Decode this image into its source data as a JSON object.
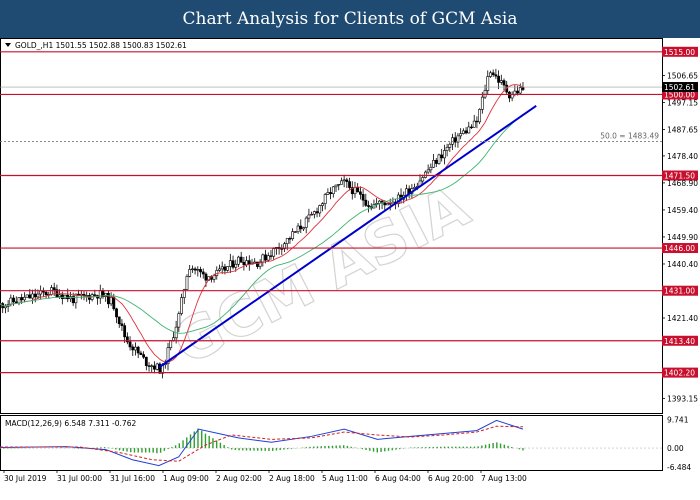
{
  "header": {
    "title": "Chart Analysis for Clients of GCM Asia"
  },
  "chart_data": {
    "type": "candlestick",
    "symbol_info": "GOLD_,H1  1501.55 1502.88 1500.83 1502.61",
    "watermark": "GCM ASIA",
    "ylim": [
      1388.0,
      1519.5
    ],
    "y_ticks": [
      "1506.65",
      "1497.15",
      "1487.65",
      "1478.40",
      "1468.90",
      "1459.40",
      "1449.90",
      "1440.40",
      "1421.40",
      "1393.15"
    ],
    "x_ticks": [
      "30 Jul 2019",
      "31 Jul 00:00",
      "31 Jul 16:00",
      "1 Aug 09:00",
      "2 Aug 02:00",
      "2 Aug 18:00",
      "5 Aug 11:00",
      "6 Aug 04:00",
      "6 Aug 20:00",
      "7 Aug 13:00"
    ],
    "current_price": "1502.61",
    "levels": [
      {
        "value": 1515.0,
        "label": "1515.00"
      },
      {
        "value": 1500.0,
        "label": "1500.00"
      },
      {
        "value": 1471.5,
        "label": "1471.50"
      },
      {
        "value": 1446.0,
        "label": "1446.00"
      },
      {
        "value": 1431.0,
        "label": "1431.00"
      },
      {
        "value": 1413.4,
        "label": "1413.40"
      },
      {
        "value": 1402.2,
        "label": "1402.20"
      }
    ],
    "fib": {
      "value": 1483.49,
      "label": "50.0 = 1483.49"
    },
    "trendline": {
      "from": [
        1404.0,
        0.24
      ],
      "to": [
        1496.0,
        0.81
      ]
    },
    "key_closes": [
      {
        "t": 0.0,
        "v": 1426
      },
      {
        "t": 0.05,
        "v": 1429
      },
      {
        "t": 0.08,
        "v": 1431
      },
      {
        "t": 0.11,
        "v": 1428
      },
      {
        "t": 0.15,
        "v": 1430
      },
      {
        "t": 0.17,
        "v": 1427
      },
      {
        "t": 0.19,
        "v": 1414
      },
      {
        "t": 0.22,
        "v": 1406
      },
      {
        "t": 0.245,
        "v": 1403
      },
      {
        "t": 0.27,
        "v": 1422
      },
      {
        "t": 0.285,
        "v": 1440
      },
      {
        "t": 0.31,
        "v": 1436
      },
      {
        "t": 0.33,
        "v": 1437
      },
      {
        "t": 0.36,
        "v": 1442
      },
      {
        "t": 0.39,
        "v": 1441
      },
      {
        "t": 0.43,
        "v": 1448
      },
      {
        "t": 0.47,
        "v": 1457
      },
      {
        "t": 0.5,
        "v": 1466
      },
      {
        "t": 0.52,
        "v": 1469
      },
      {
        "t": 0.56,
        "v": 1461
      },
      {
        "t": 0.6,
        "v": 1463
      },
      {
        "t": 0.63,
        "v": 1469
      },
      {
        "t": 0.66,
        "v": 1477
      },
      {
        "t": 0.69,
        "v": 1485
      },
      {
        "t": 0.72,
        "v": 1490
      },
      {
        "t": 0.74,
        "v": 1509
      },
      {
        "t": 0.77,
        "v": 1500
      },
      {
        "t": 0.79,
        "v": 1502
      }
    ],
    "macd": {
      "label": "MACD(12,26,9) 6.548 7.311 -0.762",
      "y_ticks": [
        "9.741",
        "0.00",
        "-6.484"
      ],
      "ylim": [
        -7.5,
        11.0
      ],
      "main": [
        {
          "t": 0.0,
          "v": 0.2
        },
        {
          "t": 0.1,
          "v": 0.5
        },
        {
          "t": 0.16,
          "v": -0.5
        },
        {
          "t": 0.2,
          "v": -4.0
        },
        {
          "t": 0.24,
          "v": -6.0
        },
        {
          "t": 0.27,
          "v": -3.0
        },
        {
          "t": 0.3,
          "v": 6.5
        },
        {
          "t": 0.33,
          "v": 5.0
        },
        {
          "t": 0.36,
          "v": 3.5
        },
        {
          "t": 0.41,
          "v": 2.0
        },
        {
          "t": 0.47,
          "v": 4.0
        },
        {
          "t": 0.52,
          "v": 6.5
        },
        {
          "t": 0.57,
          "v": 3.0
        },
        {
          "t": 0.62,
          "v": 4.0
        },
        {
          "t": 0.67,
          "v": 5.0
        },
        {
          "t": 0.72,
          "v": 6.0
        },
        {
          "t": 0.75,
          "v": 9.5
        },
        {
          "t": 0.79,
          "v": 6.5
        }
      ],
      "signal": [
        {
          "t": 0.0,
          "v": 0.4
        },
        {
          "t": 0.12,
          "v": 0.4
        },
        {
          "t": 0.18,
          "v": -1.5
        },
        {
          "t": 0.23,
          "v": -4.0
        },
        {
          "t": 0.27,
          "v": -4.5
        },
        {
          "t": 0.31,
          "v": 1.0
        },
        {
          "t": 0.35,
          "v": 4.5
        },
        {
          "t": 0.41,
          "v": 3.0
        },
        {
          "t": 0.47,
          "v": 3.5
        },
        {
          "t": 0.52,
          "v": 5.5
        },
        {
          "t": 0.57,
          "v": 4.5
        },
        {
          "t": 0.62,
          "v": 3.8
        },
        {
          "t": 0.67,
          "v": 4.5
        },
        {
          "t": 0.72,
          "v": 5.5
        },
        {
          "t": 0.75,
          "v": 7.5
        },
        {
          "t": 0.79,
          "v": 7.3
        }
      ]
    },
    "colors": {
      "level": "#c8102e",
      "trendline": "#0000cc",
      "ma_fast": "#e0303a",
      "ma_slow": "#3cb371",
      "macd_main": "#1f3fd6",
      "macd_signal": "#d42020",
      "macd_hist": "#2e9e2e",
      "current_price_bg": "#000000"
    }
  }
}
